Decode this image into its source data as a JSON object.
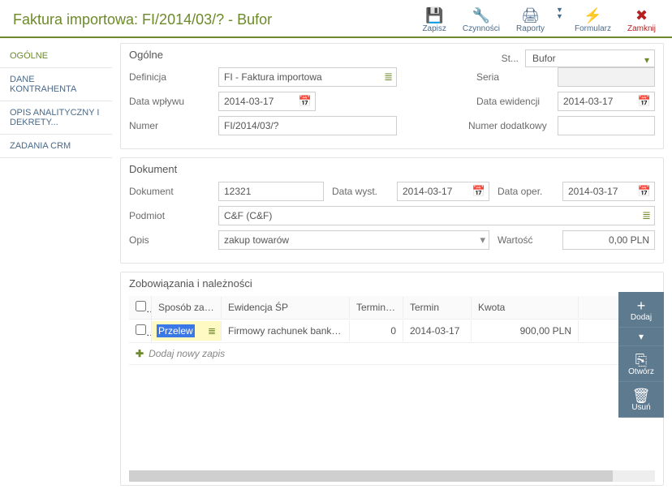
{
  "header": {
    "title": "Faktura importowa: FI/2014/03/? - Bufor",
    "tools": {
      "save": "Zapisz",
      "actions": "Czynności",
      "reports": "Raporty",
      "form": "Formularz",
      "close": "Zamknij"
    }
  },
  "sidebar": {
    "items": [
      {
        "label": "OGÓLNE"
      },
      {
        "label": "DANE KONTRAHENTA"
      },
      {
        "label": "OPIS ANALITYCZNY I DEKRETY..."
      },
      {
        "label": "ZADANIA CRM"
      }
    ]
  },
  "general": {
    "title": "Ogólne",
    "status_label": "St...",
    "status_value": "Bufor",
    "def_label": "Definicja",
    "def_value": "FI - Faktura importowa",
    "seria_label": "Seria",
    "seria_value": "",
    "data_wplywu_label": "Data wpływu",
    "data_wplywu_value": "2014-03-17",
    "data_ew_label": "Data ewidencji",
    "data_ew_value": "2014-03-17",
    "numer_label": "Numer",
    "numer_value": "FI/2014/03/?",
    "numer_d_label": "Numer dodatkowy",
    "numer_d_value": ""
  },
  "dokument": {
    "title": "Dokument",
    "dok_label": "Dokument",
    "dok_value": "12321",
    "data_wyst_label": "Data wyst.",
    "data_wyst_value": "2014-03-17",
    "data_oper_label": "Data oper.",
    "data_oper_value": "2014-03-17",
    "podmiot_label": "Podmiot",
    "podmiot_value": "C&F (C&F)",
    "opis_label": "Opis",
    "opis_value": "zakup towarów",
    "wartosc_label": "Wartość",
    "wartosc_value": "0,00 PLN"
  },
  "zobow": {
    "title": "Zobowiązania i należności",
    "cols": {
      "sposob": "Sposób zapł..",
      "ewid": "Ewidencja ŚP",
      "termin1": "Termin (...",
      "termin2": "Termin",
      "kwota": "Kwota"
    },
    "row": {
      "sposob": "Przelew",
      "ewid": "Firmowy rachunek bankowy",
      "termin1": "0",
      "termin2": "2014-03-17",
      "kwota": "900,00 PLN"
    },
    "add_row": "Dodaj nowy zapis"
  },
  "rail": {
    "add": "Dodaj",
    "open": "Otwórz",
    "del": "Usuń"
  }
}
